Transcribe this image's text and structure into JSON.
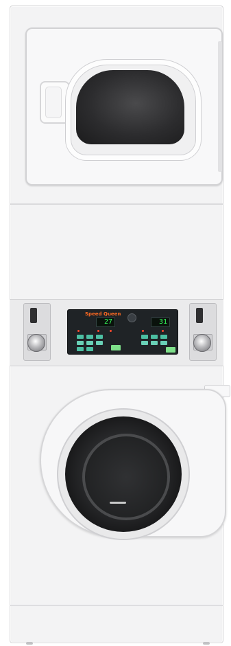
{
  "product": {
    "brand": "Speed Queen",
    "type": "stacked washer/dryer"
  },
  "console": {
    "left_display": "27",
    "right_display": "31"
  },
  "colors": {
    "cabinet": "#f3f3f4",
    "panel": "#ebebec",
    "console": "#1f2326",
    "brand_orange": "#ff6a22",
    "lcd_green": "#35ff5c",
    "glass": "#1b1b1c"
  },
  "icons": {
    "left_coin_box": "coin-slot-icon",
    "right_coin_box": "coin-slot-icon",
    "lock": "lock-icon"
  }
}
